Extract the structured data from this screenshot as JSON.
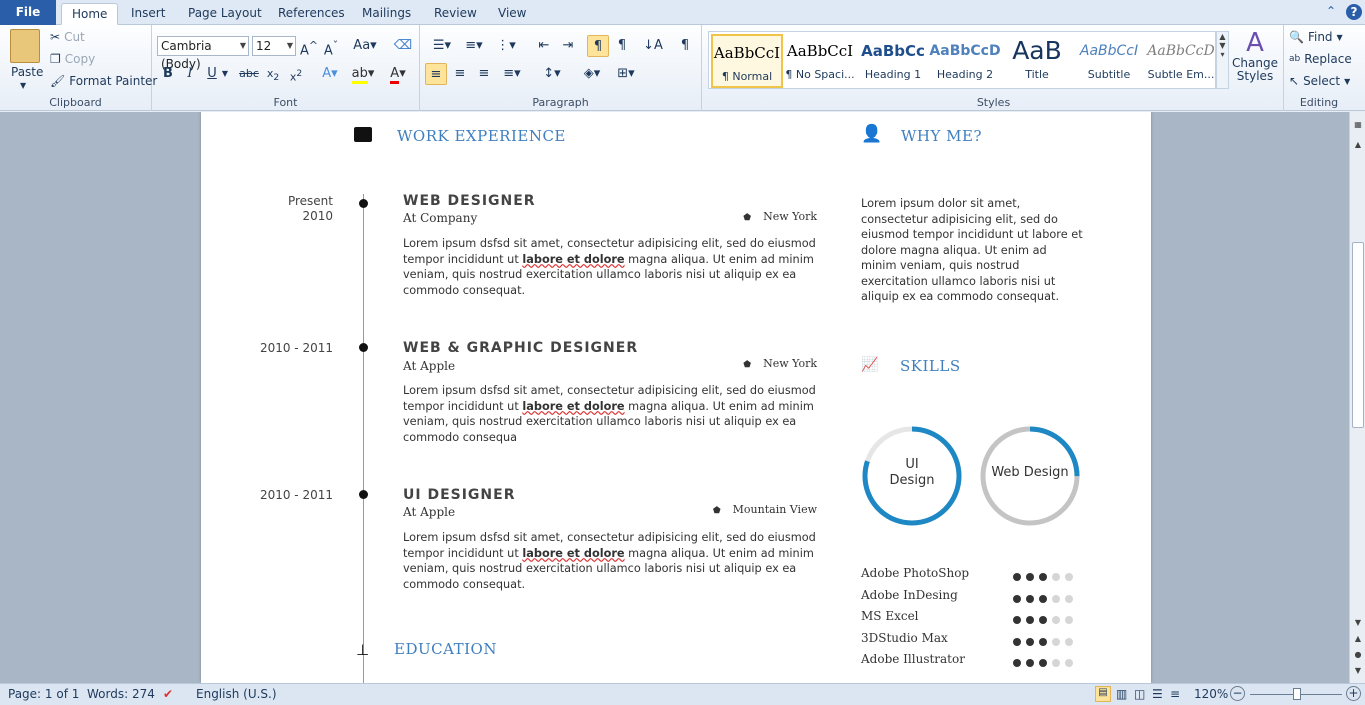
{
  "tabs": {
    "file": "File",
    "home": "Home",
    "insert": "Insert",
    "page_layout": "Page Layout",
    "references": "References",
    "mailings": "Mailings",
    "review": "Review",
    "view": "View"
  },
  "clipboard": {
    "paste": "Paste",
    "cut": "Cut",
    "copy": "Copy",
    "format_painter": "Format Painter",
    "label": "Clipboard"
  },
  "font": {
    "family": "Cambria (Body)",
    "size": "12",
    "label": "Font"
  },
  "paragraph": {
    "label": "Paragraph"
  },
  "styles": {
    "items": [
      "¶ Normal",
      "¶ No Spaci...",
      "Heading 1",
      "Heading 2",
      "Title",
      "Subtitle",
      "Subtle Em..."
    ],
    "preview": [
      "AaBbCcI",
      "AaBbCcI",
      "AaBbCc",
      "AaBbCcD",
      "AaB",
      "AaBbCcI",
      "AaBbCcD"
    ],
    "change_styles": "Change Styles",
    "label": "Styles"
  },
  "editing": {
    "find": "Find",
    "replace": "Replace",
    "select": "Select",
    "label": "Editing"
  },
  "resume": {
    "work_heading": "WORK EXPERIENCE",
    "why_heading": "WHY ME?",
    "skills_heading": "SKILLS",
    "education_heading": "EDUCATION",
    "jobs": [
      {
        "date1": "Present",
        "date2": "2010",
        "title": "WEB DESIGNER",
        "company": "At Company",
        "location": "New York"
      },
      {
        "date1": "2010  -  2011",
        "date2": "",
        "title": "WEB & GRAPHIC DESIGNER",
        "company": "At Apple",
        "location": "New York"
      },
      {
        "date1": "2010  -  2011",
        "date2": "",
        "title": "UI DESIGNER",
        "company": "At Apple",
        "location": "Mountain View"
      }
    ],
    "job_para": {
      "a": "Lorem ipsum dsfsd sit amet, consectetur adipisicing elit, sed do eiusmod tempor incididunt ut ",
      "b": "labore et dolore",
      "c": " magna aliqua. Ut enim ad minim veniam, quis nostrud exercitation ullamco laboris nisi ut aliquip ex ea commodo consequat.",
      "c2": " magna aliqua. Ut enim ad minim veniam, quis nostrud exercitation ullamco laboris nisi ut aliquip ex ea commodo consequa"
    },
    "why_text": "Lorem ipsum dolor sit amet, consectetur adipisicing elit, sed do eiusmod tempor incididunt ut labore et dolore magna aliqua. Ut enim ad minim veniam, quis nostrud exercitation ullamco laboris nisi ut aliquip ex ea commodo consequat.",
    "circles": [
      {
        "label": "UI Design",
        "fraction": 0.8
      },
      {
        "label": "Web Design",
        "fraction": 0.25
      }
    ],
    "skills": [
      {
        "name": "Adobe PhotoShop",
        "level": 3
      },
      {
        "name": "Adobe InDesing",
        "level": 3
      },
      {
        "name": "MS Excel",
        "level": 3
      },
      {
        "name": "3DStudio Max",
        "level": 3
      },
      {
        "name": "Adobe Illustrator",
        "level": 3
      }
    ]
  },
  "status": {
    "page": "Page: 1 of 1",
    "words": "Words: 274",
    "language": "English (U.S.)",
    "zoom": "120%"
  }
}
